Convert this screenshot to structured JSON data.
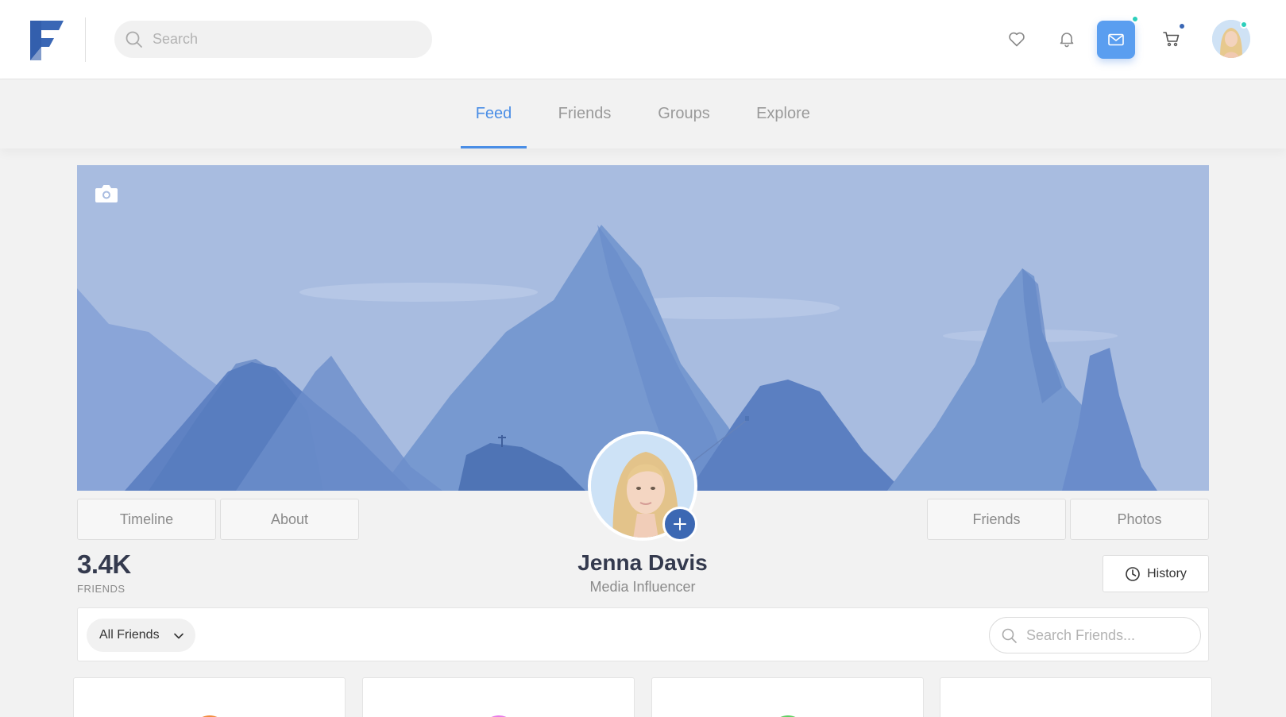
{
  "header": {
    "search_placeholder": "Search",
    "icons": [
      "heart-icon",
      "bell-icon",
      "mail-icon",
      "cart-icon"
    ],
    "accent_color": "#5a9ef0",
    "notification_dot_colors": [
      "#2ccfbb",
      "#3a67b5"
    ]
  },
  "tabs": [
    {
      "label": "Feed",
      "active": true
    },
    {
      "label": "Friends",
      "active": false
    },
    {
      "label": "Groups",
      "active": false
    },
    {
      "label": "Explore",
      "active": false
    }
  ],
  "profile": {
    "name": "Jenna Davis",
    "role": "Media Influencer",
    "friends_count": "3.4K",
    "friends_label": "FRIENDS",
    "left_buttons": [
      "Timeline",
      "About"
    ],
    "right_buttons": [
      "Friends",
      "Photos"
    ],
    "history_label": "History"
  },
  "filter": {
    "dropdown_value": "All Friends",
    "search_placeholder": "Search Friends..."
  },
  "cards": [
    {
      "accent": "#f28b3c"
    },
    {
      "accent": "#e77be8"
    },
    {
      "accent": "#5fcf63"
    },
    {
      "accent": "#ffffff"
    }
  ]
}
